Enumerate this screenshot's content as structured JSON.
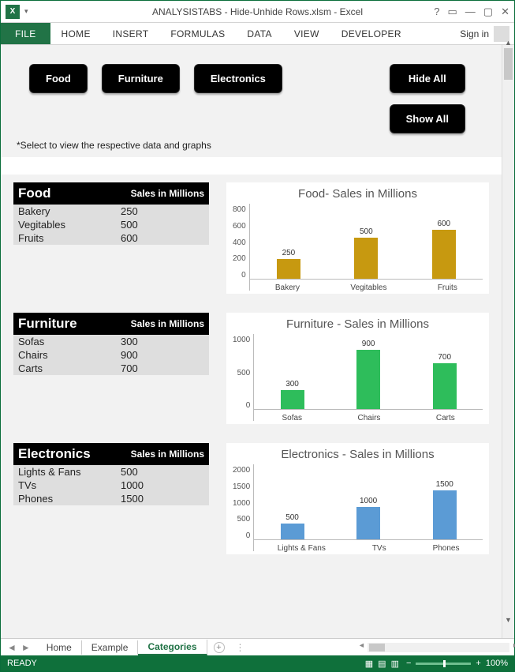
{
  "window": {
    "title": "ANALYSISTABS - Hide-Unhide Rows.xlsm - Excel",
    "help_icon": "?",
    "ribbon_opts_icon": "▭",
    "min_icon": "—",
    "max_icon": "▢",
    "close_icon": "✕"
  },
  "ribbon": {
    "file": "FILE",
    "tabs": [
      "HOME",
      "INSERT",
      "FORMULAS",
      "DATA",
      "VIEW",
      "DEVELOPER"
    ],
    "signin": "Sign in"
  },
  "sheet": {
    "buttons": {
      "food": "Food",
      "furniture": "Furniture",
      "electronics": "Electronics",
      "hide": "Hide All",
      "show": "Show All"
    },
    "note": "*Select to view the respective data and graphs",
    "sections": [
      {
        "name": "Food",
        "header2": "Sales in Millions",
        "rows": [
          [
            "Bakery",
            "250"
          ],
          [
            "Vegitables",
            "500"
          ],
          [
            "Fruits",
            "600"
          ]
        ]
      },
      {
        "name": "Furniture",
        "header2": "Sales in Millions",
        "rows": [
          [
            "Sofas",
            "300"
          ],
          [
            "Chairs",
            "900"
          ],
          [
            "Carts",
            "700"
          ]
        ]
      },
      {
        "name": "Electronics",
        "header2": "Sales in Millions",
        "rows": [
          [
            "Lights & Fans",
            "500"
          ],
          [
            "TVs",
            "1000"
          ],
          [
            "Phones",
            "1500"
          ]
        ]
      }
    ]
  },
  "chart_data": [
    {
      "type": "bar",
      "title": "Food- Sales in Millions",
      "categories": [
        "Bakery",
        "Vegitables",
        "Fruits"
      ],
      "values": [
        250,
        500,
        600
      ],
      "yticks": [
        800,
        600,
        400,
        200,
        0
      ],
      "ylim": [
        0,
        800
      ],
      "color": "#c79910",
      "xlabel": "",
      "ylabel": ""
    },
    {
      "type": "bar",
      "title": "Furniture - Sales in Millions",
      "categories": [
        "Sofas",
        "Chairs",
        "Carts"
      ],
      "values": [
        300,
        900,
        700
      ],
      "yticks": [
        1000,
        500,
        0
      ],
      "ylim": [
        0,
        1000
      ],
      "color": "#2ebd5b",
      "xlabel": "",
      "ylabel": ""
    },
    {
      "type": "bar",
      "title": "Electronics - Sales in Millions",
      "categories": [
        "Lights & Fans",
        "TVs",
        "Phones"
      ],
      "values": [
        500,
        1000,
        1500
      ],
      "yticks": [
        2000,
        1500,
        1000,
        500,
        0
      ],
      "ylim": [
        0,
        2000
      ],
      "color": "#5b9bd5",
      "xlabel": "",
      "ylabel": ""
    }
  ],
  "tabs": {
    "list": [
      "Home",
      "Example",
      "Categories"
    ],
    "active": "Categories"
  },
  "status": {
    "ready": "READY",
    "zoom": "100%"
  }
}
